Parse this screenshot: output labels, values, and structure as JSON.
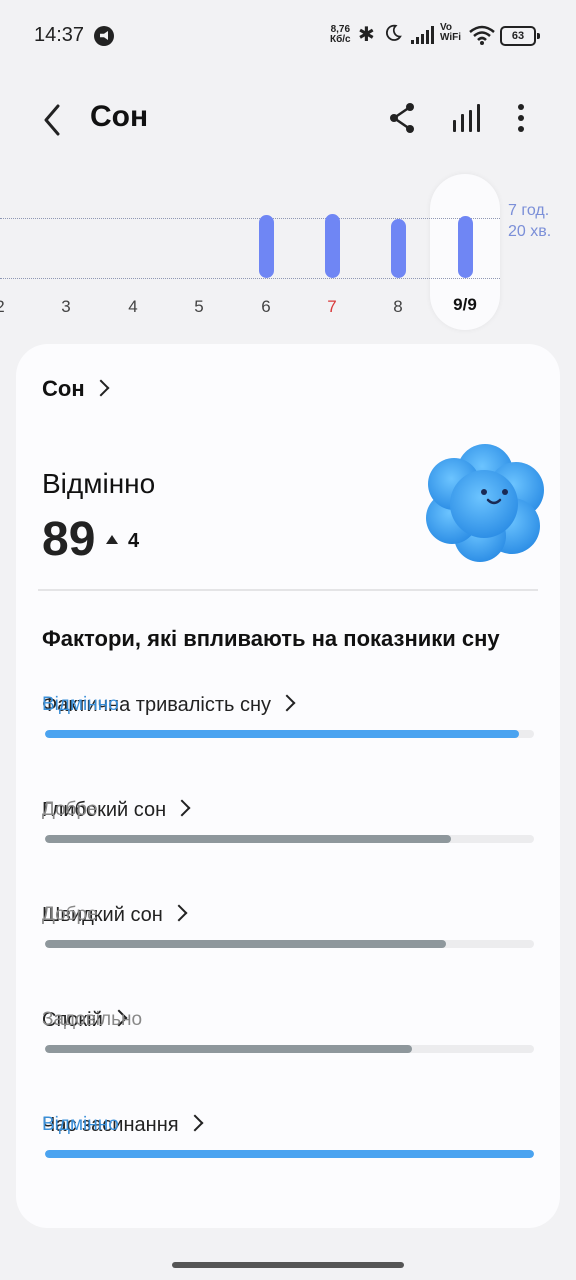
{
  "status_bar": {
    "time": "14:37",
    "speed_value": "8,76",
    "speed_unit": "Кб/с",
    "vowifi_top": "Vo",
    "vowifi_bottom": "WiFi",
    "battery": "63",
    "icons": [
      "record-icon",
      "bluetooth-icon",
      "moon-icon",
      "signal-icon",
      "wifi-icon",
      "battery-icon"
    ]
  },
  "header": {
    "title": "Сон",
    "icons": [
      "back-icon",
      "share-icon",
      "stats-icon",
      "more-icon"
    ]
  },
  "chart_data": {
    "type": "bar",
    "categories": [
      "2",
      "3",
      "4",
      "5",
      "6",
      "7",
      "8",
      "9/9"
    ],
    "values": [
      null,
      null,
      null,
      null,
      7.4,
      7.6,
      7.0,
      7.33
    ],
    "goal_label_line1": "7 год.",
    "goal_label_line2": "20 хв.",
    "selected": "9/9",
    "highlight_category": "7",
    "highlight_color": "#d93a3a",
    "bar_color": "#6f86f4"
  },
  "card": {
    "section_title": "Сон",
    "rating": "Відмінно",
    "score": "89",
    "delta": "4",
    "mascot_icon": "blue-cloud-mascot-icon",
    "factors_title": "Фактори, які впливають на показники сну",
    "factors": [
      {
        "name": "Фактична тривалість сну",
        "status": "Відмінно",
        "level": 0.97,
        "color": "#4aa3f0",
        "status_color": "#3a8fd8"
      },
      {
        "name": "Глибокий сон",
        "status": "Добре",
        "level": 0.83,
        "color": "#8e979c",
        "status_color": "#888888"
      },
      {
        "name": "Швидкий сон",
        "status": "Добре",
        "level": 0.82,
        "color": "#8e979c",
        "status_color": "#888888"
      },
      {
        "name": "Спокій",
        "status": "Задовільно",
        "level": 0.75,
        "color": "#8e979c",
        "status_color": "#888888"
      },
      {
        "name": "Час засинання",
        "status": "Відмінно",
        "level": 1.0,
        "color": "#4aa3f0",
        "status_color": "#3a8fd8"
      }
    ]
  }
}
